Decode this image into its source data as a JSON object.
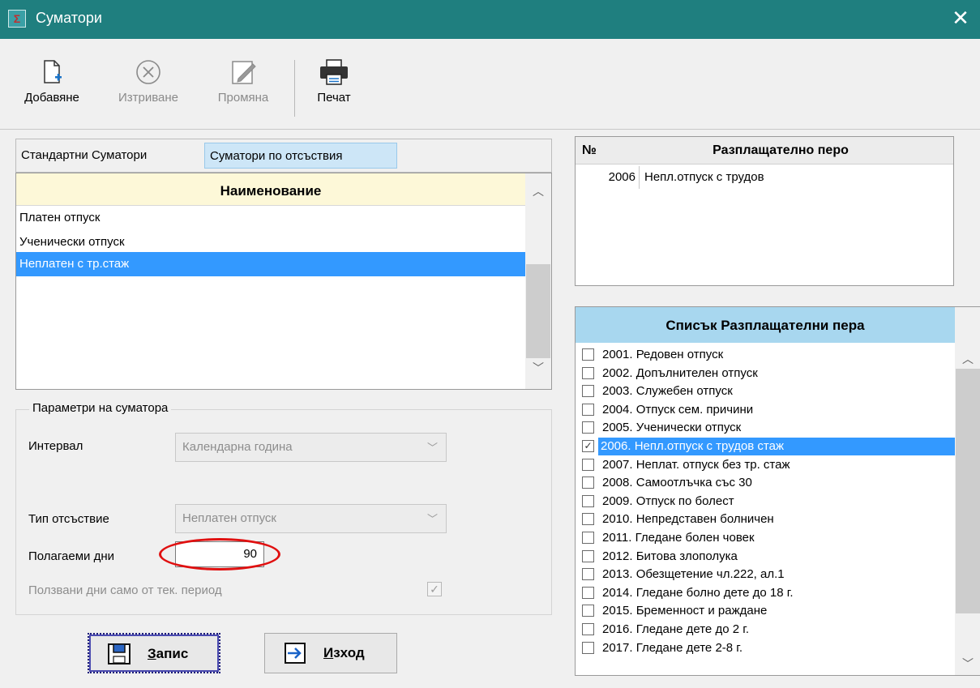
{
  "window": {
    "title": "Суматори",
    "app_icon": "Σ",
    "close_glyph": "✕"
  },
  "toolbar": {
    "add_label": "Добавяне",
    "delete_label": "Изтриване",
    "edit_label": "Промяна",
    "print_label": "Печат"
  },
  "tabs": [
    {
      "label": "Стандартни Суматори",
      "active": false
    },
    {
      "label": "Суматори по отсъствия",
      "active": true
    }
  ],
  "summators": {
    "header": "Наименование",
    "rows": [
      "Платен отпуск",
      "Ученически отпуск",
      "Неплатен с тр.стаж"
    ],
    "selected_index": 2
  },
  "params": {
    "legend": "Параметри на суматора",
    "interval_label": "Интервал",
    "interval_value": "Календарна година",
    "absence_type_label": "Тип отсъствие",
    "absence_type_value": "Неплатен отпуск",
    "days_label": "Полагаеми дни",
    "days_value": "90",
    "used_days_label": "Ползвани дни само от тек. период",
    "used_days_checked": true
  },
  "buttons": {
    "save_label": "Запис",
    "save_hotkey": "З",
    "save_rest": "апис",
    "exit_hotkey": "И",
    "exit_rest": "зход"
  },
  "payroll_table": {
    "col_no": "№",
    "col_name": "Разплащателно перо",
    "rows": [
      {
        "no": "2006",
        "name": "Непл.отпуск с трудов"
      }
    ]
  },
  "payroll_list": {
    "header": "Списък Разплащателни пера",
    "items": [
      {
        "label": "2001. Редовен отпуск",
        "checked": false
      },
      {
        "label": "2002. Допълнителен отпуск",
        "checked": false
      },
      {
        "label": "2003. Служебен отпуск",
        "checked": false
      },
      {
        "label": "2004. Отпуск сем. причини",
        "checked": false
      },
      {
        "label": "2005. Ученически отпуск",
        "checked": false
      },
      {
        "label": "2006. Непл.отпуск с трудов стаж",
        "checked": true
      },
      {
        "label": "2007. Неплат. отпуск без тр. стаж",
        "checked": false
      },
      {
        "label": "2008. Самоотлъчка със 30",
        "checked": false
      },
      {
        "label": "2009. Отпуск по болест",
        "checked": false
      },
      {
        "label": "2010. Непредставен болничен",
        "checked": false
      },
      {
        "label": "2011. Гледане болен човек",
        "checked": false
      },
      {
        "label": "2012. Битова злополука",
        "checked": false
      },
      {
        "label": "2013. Обезщетение чл.222, ал.1",
        "checked": false
      },
      {
        "label": "2014. Гледане болно дете до 18 г.",
        "checked": false
      },
      {
        "label": "2015. Бременност и раждане",
        "checked": false
      },
      {
        "label": "2016. Гледане дете до 2 г.",
        "checked": false
      },
      {
        "label": "2017. Гледане дете 2-8 г.",
        "checked": false
      }
    ],
    "selected_index": 5
  },
  "colors": {
    "titlebar": "#1f7f7f",
    "selection": "#3399ff",
    "list_header": "#a8d7ef",
    "annotation": "#e01010"
  }
}
